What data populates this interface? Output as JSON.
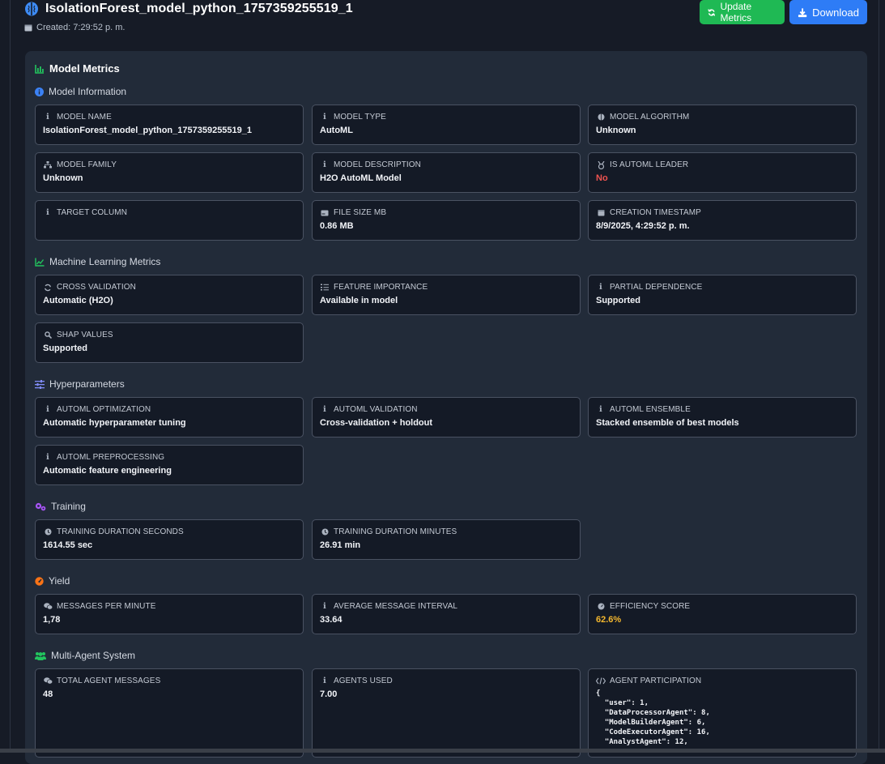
{
  "header": {
    "title": "IsolationForest_model_python_1757359255519_1",
    "created": "Created: 7:29:52 p. m.",
    "update_button": "Update Metrics",
    "download_button": "Download"
  },
  "panel": {
    "title": "Model Metrics",
    "sections": {
      "model_info": {
        "title": "Model Information",
        "cards": [
          {
            "label": "MODEL NAME",
            "value": "IsolationForest_model_python_1757359255519_1",
            "icon": "info-icon"
          },
          {
            "label": "MODEL TYPE",
            "value": "AutoML",
            "icon": "info-icon"
          },
          {
            "label": "MODEL ALGORITHM",
            "value": "Unknown",
            "icon": "brain-icon"
          },
          {
            "label": "MODEL FAMILY",
            "value": "Unknown",
            "icon": "sitemap-icon"
          },
          {
            "label": "MODEL DESCRIPTION",
            "value": "H2O AutoML Model",
            "icon": "info-icon"
          },
          {
            "label": "IS AUTOML LEADER",
            "value": "No",
            "icon": "medal-icon"
          },
          {
            "label": "TARGET COLUMN",
            "value": "",
            "icon": "info-icon"
          },
          {
            "label": "FILE SIZE MB",
            "value": "0.86 MB",
            "icon": "hdd-icon"
          },
          {
            "label": "CREATION TIMESTAMP",
            "value": "8/9/2025, 4:29:52 p. m.",
            "icon": "calendar-icon"
          }
        ]
      },
      "ml_metrics": {
        "title": "Machine Learning Metrics",
        "cards": [
          {
            "label": "CROSS VALIDATION",
            "value": "Automatic (H2O)",
            "icon": "sync-icon"
          },
          {
            "label": "FEATURE IMPORTANCE",
            "value": "Available in model",
            "icon": "list-ordered-icon"
          },
          {
            "label": "PARTIAL DEPENDENCE",
            "value": "Supported",
            "icon": "info-icon"
          },
          {
            "label": "SHAP VALUES",
            "value": "Supported",
            "icon": "search-icon"
          }
        ]
      },
      "hyperparameters": {
        "title": "Hyperparameters",
        "cards": [
          {
            "label": "AUTOML OPTIMIZATION",
            "value": "Automatic hyperparameter tuning",
            "icon": "info-icon"
          },
          {
            "label": "AUTOML VALIDATION",
            "value": "Cross-validation + holdout",
            "icon": "info-icon"
          },
          {
            "label": "AUTOML ENSEMBLE",
            "value": "Stacked ensemble of best models",
            "icon": "info-icon"
          },
          {
            "label": "AUTOML PREPROCESSING",
            "value": "Automatic feature engineering",
            "icon": "info-icon"
          }
        ]
      },
      "training": {
        "title": "Training",
        "cards": [
          {
            "label": "TRAINING DURATION SECONDS",
            "value": "1614.55 sec",
            "icon": "clock-icon"
          },
          {
            "label": "TRAINING DURATION MINUTES",
            "value": "26.91 min",
            "icon": "clock-icon"
          }
        ]
      },
      "yield": {
        "title": "Yield",
        "cards": [
          {
            "label": "MESSAGES PER MINUTE",
            "value": "1,78",
            "icon": "comments-icon"
          },
          {
            "label": "AVERAGE MESSAGE INTERVAL",
            "value": "33.64",
            "icon": "info-icon"
          },
          {
            "label": "EFFICIENCY SCORE",
            "value": "62.6%",
            "icon": "dial-icon"
          }
        ]
      },
      "multi_agent": {
        "title": "Multi-Agent System",
        "cards": [
          {
            "label": "TOTAL AGENT MESSAGES",
            "value": "48",
            "icon": "comments-icon"
          },
          {
            "label": "AGENTS USED",
            "value": "7.00",
            "icon": "info-icon"
          },
          {
            "label": "AGENT PARTICIPATION",
            "value": "{\n  \"user\": 1,\n  \"DataProcessorAgent\": 8,\n  \"ModelBuilderAgent\": 6,\n  \"CodeExecutorAgent\": 16,\n  \"AnalystAgent\": 12,",
            "icon": "code-icon"
          }
        ]
      }
    }
  },
  "colors": {
    "background": "#161b26",
    "panel": "#222b39",
    "card": "#141a26",
    "update_button": "#1fb954",
    "download_button": "#2e7cf6",
    "negative": "#ef5350",
    "warning": "#f5b82e"
  }
}
